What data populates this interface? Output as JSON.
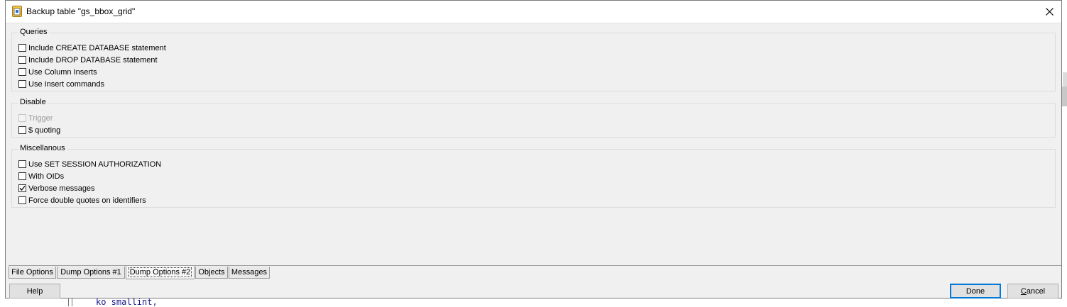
{
  "dialog": {
    "title": "Backup table \"gs_bbox_grid\"",
    "icon": "backup-table-icon",
    "close_icon": "close-icon"
  },
  "groups": [
    {
      "title": "Queries",
      "options": [
        {
          "label": "Include CREATE DATABASE statement",
          "checked": false,
          "disabled": false
        },
        {
          "label": "Include DROP DATABASE statement",
          "checked": false,
          "disabled": false
        },
        {
          "label": "Use Column Inserts",
          "checked": false,
          "disabled": false
        },
        {
          "label": "Use Insert commands",
          "checked": false,
          "disabled": false
        }
      ]
    },
    {
      "title": "Disable",
      "options": [
        {
          "label": "Trigger",
          "checked": false,
          "disabled": true
        },
        {
          "label": "$ quoting",
          "checked": false,
          "disabled": false
        }
      ]
    },
    {
      "title": "Miscellanous",
      "options": [
        {
          "label": "Use SET SESSION AUTHORIZATION",
          "checked": false,
          "disabled": false
        },
        {
          "label": "With OIDs",
          "checked": false,
          "disabled": false
        },
        {
          "label": "Verbose messages",
          "checked": true,
          "disabled": false
        },
        {
          "label": "Force double quotes on identifiers",
          "checked": false,
          "disabled": false
        }
      ]
    }
  ],
  "tabs": [
    {
      "label": "File Options",
      "active": false
    },
    {
      "label": "Dump Options #1",
      "active": false
    },
    {
      "label": "Dump Options #2",
      "active": true
    },
    {
      "label": "Objects",
      "active": false
    },
    {
      "label": "Messages",
      "active": false
    }
  ],
  "buttons": {
    "help": "Help",
    "done": "Done",
    "cancel": "Cancel"
  },
  "background": {
    "code_text": "ko smallint,"
  }
}
